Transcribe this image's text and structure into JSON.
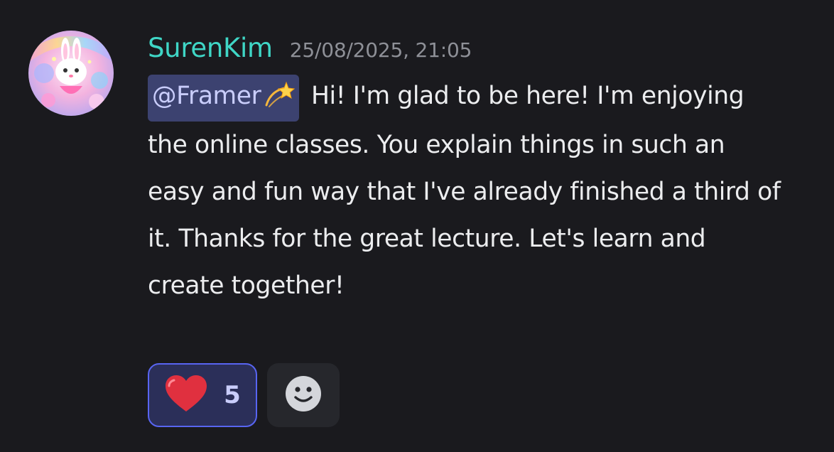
{
  "message": {
    "username": "SurenKim",
    "timestamp": "25/08/2025, 21:05",
    "mention": "@Framer",
    "mention_emoji": "dizzy-star-icon",
    "text": "Hi! I'm glad to be here! I'm enjoying the online classes. You explain things in such an easy and fun way that I've already finished a third of it. Thanks for the great lecture. Let's learn and create together!"
  },
  "reactions": [
    {
      "icon": "heart-icon",
      "count": "5",
      "selected": true
    }
  ],
  "add_reaction": {
    "icon": "smiley-face-icon"
  },
  "colors": {
    "background": "#1a1a1e",
    "username": "#3fd6c6",
    "timestamp": "#8e9097",
    "mention_bg": "#3c4270",
    "mention_text": "#c9cdfb",
    "reaction_border": "#5865f2",
    "heart": "#e0303f"
  }
}
